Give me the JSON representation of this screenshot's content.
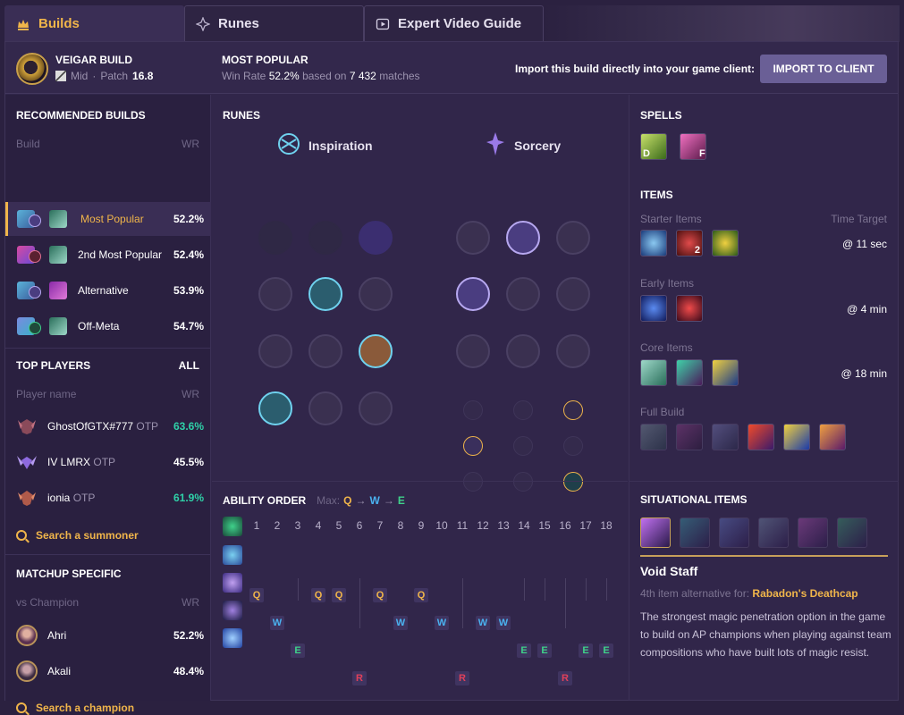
{
  "tabs": [
    {
      "label": "Builds",
      "active": true
    },
    {
      "label": "Runes",
      "active": false
    },
    {
      "label": "Expert Video Guide",
      "active": false
    }
  ],
  "header": {
    "build_title": "VEIGAR BUILD",
    "role": "Mid",
    "patch_label": "Patch",
    "patch": "16.8",
    "most_popular": "MOST POPULAR",
    "winrate_label": "Win Rate",
    "winrate": "52.2%",
    "based_on": "based on",
    "matches": "7 432",
    "matches_label": "matches",
    "import_text": "Import this build directly into your game client:",
    "import_button": "IMPORT TO CLIENT"
  },
  "recommended": {
    "title": "RECOMMENDED BUILDS",
    "col_build": "Build",
    "col_wr": "WR",
    "builds": [
      {
        "label": "Most Popular",
        "wr": "52.2%"
      },
      {
        "label": "2nd Most Popular",
        "wr": "52.4%"
      },
      {
        "label": "Alternative",
        "wr": "53.9%"
      },
      {
        "label": "Off-Meta",
        "wr": "54.7%"
      }
    ]
  },
  "top_players": {
    "title": "TOP PLAYERS",
    "all": "ALL",
    "col_name": "Player name",
    "col_wr": "WR",
    "players": [
      {
        "name": "GhostOfGTX#777",
        "tag": "OTP",
        "wr": "63.6%",
        "color": "#2fd1a8"
      },
      {
        "name": "IV LMRX",
        "tag": "OTP",
        "wr": "45.5%",
        "color": "#ffffff"
      },
      {
        "name": "ionia",
        "tag": "OTP",
        "wr": "61.9%",
        "color": "#2fd1a8"
      }
    ],
    "search": "Search a summoner"
  },
  "matchup": {
    "title": "MATCHUP SPECIFIC",
    "col_vs": "vs Champion",
    "col_wr": "WR",
    "champions": [
      {
        "name": "Ahri",
        "wr": "52.2%"
      },
      {
        "name": "Akali",
        "wr": "48.4%"
      }
    ],
    "search": "Search a champion"
  },
  "runes": {
    "title": "RUNES",
    "primary": "Inspiration",
    "secondary": "Sorcery"
  },
  "ability_order": {
    "title": "ABILITY ORDER",
    "max_label": "Max:",
    "max": [
      "Q",
      "W",
      "E"
    ],
    "levels": [
      "1",
      "2",
      "3",
      "4",
      "5",
      "6",
      "7",
      "8",
      "9",
      "10",
      "11",
      "12",
      "13",
      "14",
      "15",
      "16",
      "17",
      "18"
    ],
    "sequence": [
      "Q",
      "W",
      "E",
      "Q",
      "Q",
      "R",
      "Q",
      "W",
      "Q",
      "W",
      "R",
      "W",
      "W",
      "E",
      "E",
      "R",
      "E",
      "E"
    ]
  },
  "spells": {
    "title": "SPELLS",
    "keys": [
      "D",
      "F"
    ]
  },
  "items": {
    "title": "ITEMS",
    "starter": "Starter Items",
    "time_target": "Time Target",
    "starter_time": "@ 11 sec",
    "potion_count": "2",
    "early": "Early Items",
    "early_time": "@ 4 min",
    "core": "Core Items",
    "core_time": "@ 18 min",
    "full": "Full Build"
  },
  "situational": {
    "title": "SITUATIONAL ITEMS",
    "item_name": "Void Staff",
    "alt_prefix": "4th item alternative for:",
    "alt_item": "Rabadon's Deathcap",
    "description": "The strongest magic penetration option in the game to build on AP champions when playing against team compositions who have built lots of magic resist."
  },
  "colors": {
    "accent": "#f0b54a",
    "q": "#f0b54a",
    "w": "#4ab2f0",
    "e": "#3fd18a",
    "r": "#e0405a",
    "positive": "#2fd1a8"
  }
}
